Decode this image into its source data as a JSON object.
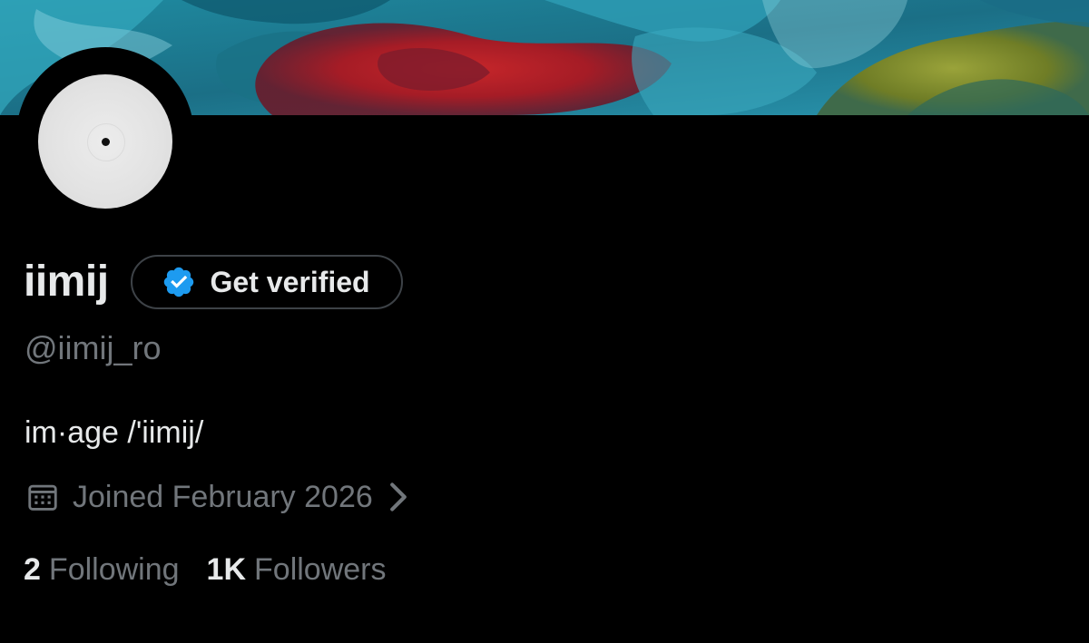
{
  "profile": {
    "display_name": "iimij",
    "handle": "@iimij_ro",
    "bio": "im·age /'iimij/",
    "joined": "Joined February 2026"
  },
  "verify_button": {
    "label": "Get verified"
  },
  "stats": {
    "following_count": "2",
    "following_label": "Following",
    "followers_count": "1K",
    "followers_label": "Followers"
  },
  "icons": {
    "verified_badge": "verified-badge-icon",
    "calendar": "calendar-icon",
    "chevron": "chevron-right-icon"
  },
  "colors": {
    "background": "#000000",
    "primary_text": "#e7e9ea",
    "secondary_text": "#71767b",
    "verified_blue": "#1d9bf0",
    "button_border": "#3d4247"
  }
}
